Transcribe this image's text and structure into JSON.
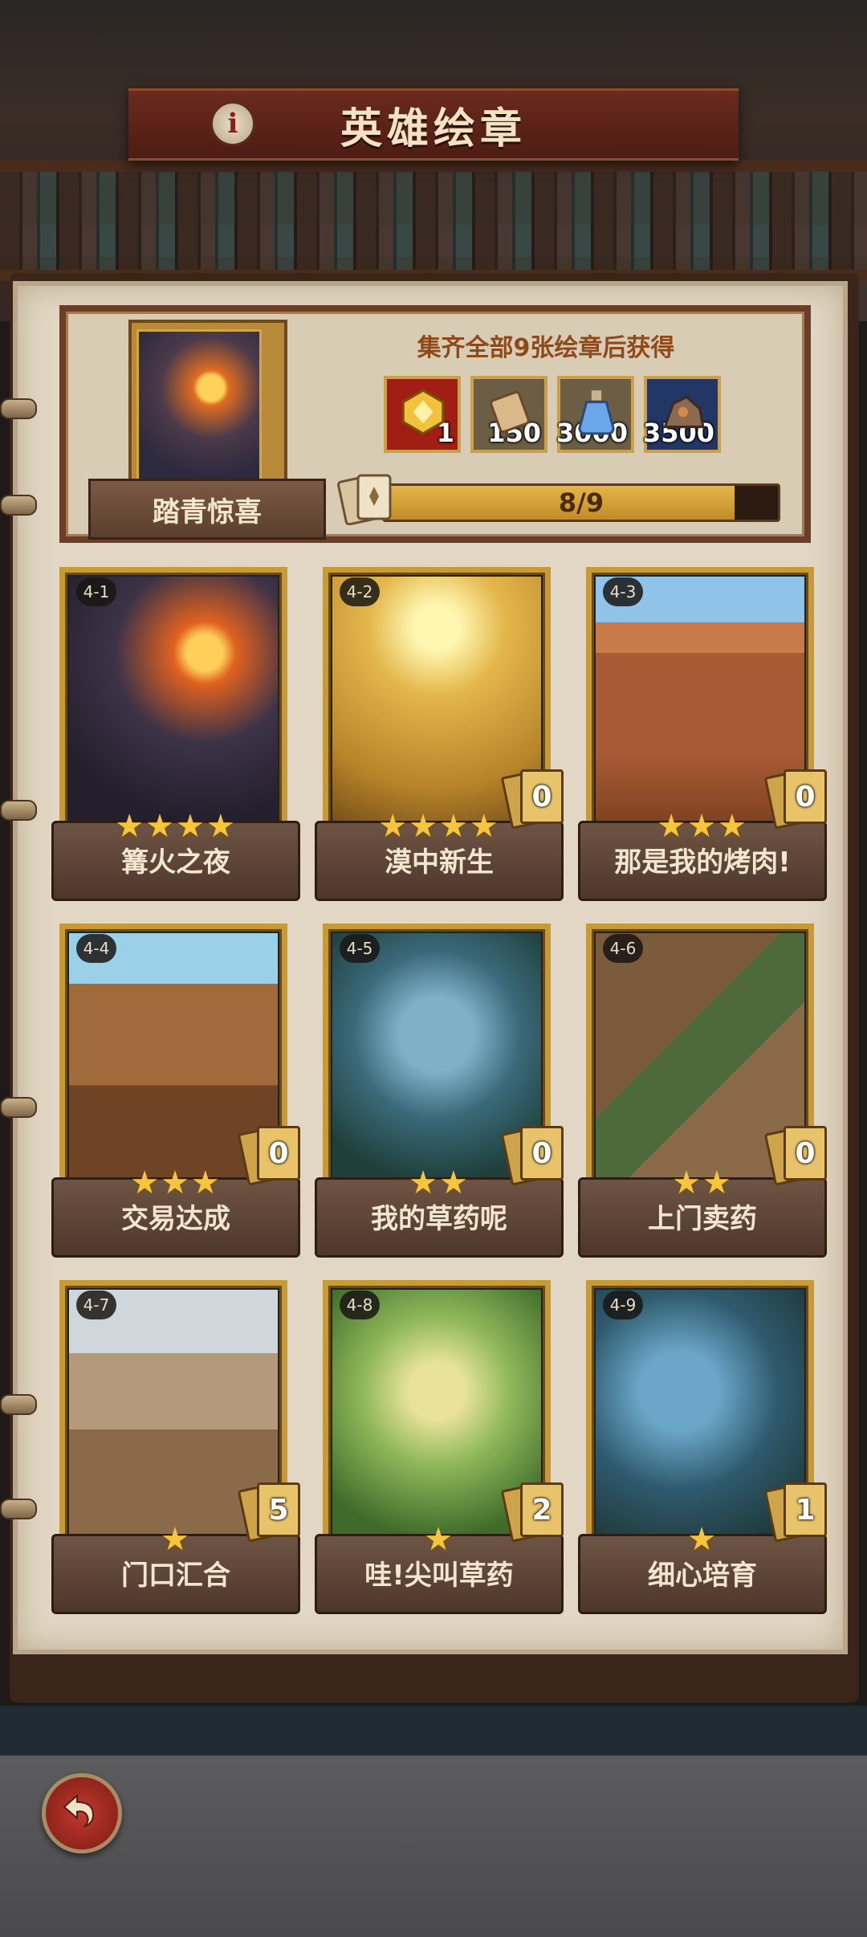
{
  "header": {
    "title": "英雄绘章",
    "info_icon": "i"
  },
  "reward_panel": {
    "collection_label": "踏青惊喜",
    "caption": "集齐全部9张绘章后获得",
    "rewards": [
      {
        "icon": "gold-crystal-icon",
        "count": "1",
        "bg": "#a11e14"
      },
      {
        "icon": "scroll-icon",
        "count": "150",
        "bg": "#6c5e44"
      },
      {
        "icon": "potion-icon",
        "count": "3000",
        "bg": "#6c5e44"
      },
      {
        "icon": "ore-icon",
        "count": "3500",
        "bg": "#233766"
      }
    ],
    "progress": {
      "text": "8/9",
      "value": 0.889
    }
  },
  "cards": [
    {
      "id": "4-1",
      "title": "篝火之夜",
      "stars": "★★★★",
      "count": ""
    },
    {
      "id": "4-2",
      "title": "漠中新生",
      "stars": "★★★★",
      "count": "0"
    },
    {
      "id": "4-3",
      "title": "那是我的烤肉!",
      "stars": "★★★",
      "count": "0"
    },
    {
      "id": "4-4",
      "title": "交易达成",
      "stars": "★★★",
      "count": "0"
    },
    {
      "id": "4-5",
      "title": "我的草药呢",
      "stars": "★★",
      "count": "0"
    },
    {
      "id": "4-6",
      "title": "上门卖药",
      "stars": "★★",
      "count": "0"
    },
    {
      "id": "4-7",
      "title": "门口汇合",
      "stars": "★",
      "count": "5"
    },
    {
      "id": "4-8",
      "title": "哇!尖叫草药",
      "stars": "★",
      "count": "2"
    },
    {
      "id": "4-9",
      "title": "细心培育",
      "stars": "★",
      "count": "1"
    }
  ],
  "colors": {
    "accent_gold": "#c79a38",
    "banner_red": "#6b2a1e",
    "parchment": "#e2d7c4"
  }
}
